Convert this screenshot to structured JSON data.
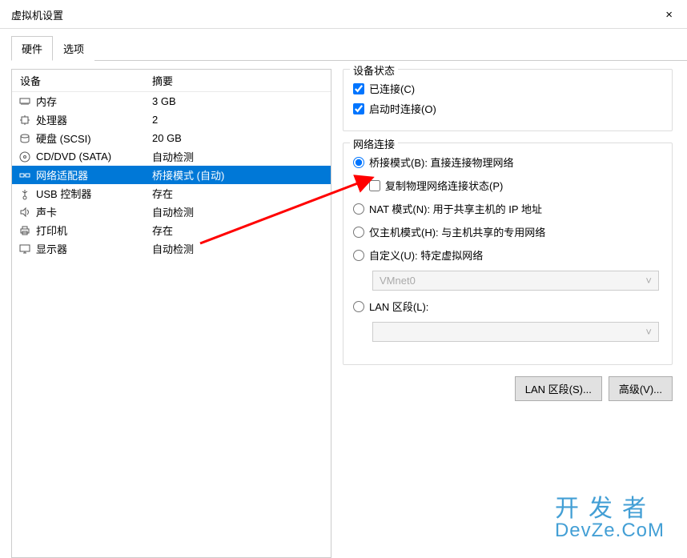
{
  "window": {
    "title": "虚拟机设置",
    "close_label": "×"
  },
  "tabs": {
    "hardware": "硬件",
    "options": "选项"
  },
  "table": {
    "header_device": "设备",
    "header_summary": "摘要",
    "rows": [
      {
        "icon": "memory",
        "name": "内存",
        "summary": "3 GB"
      },
      {
        "icon": "cpu",
        "name": "处理器",
        "summary": "2"
      },
      {
        "icon": "disk",
        "name": "硬盘 (SCSI)",
        "summary": "20 GB"
      },
      {
        "icon": "disc",
        "name": "CD/DVD (SATA)",
        "summary": "自动检测"
      },
      {
        "icon": "network",
        "name": "网络适配器",
        "summary": "桥接模式 (自动)"
      },
      {
        "icon": "usb",
        "name": "USB 控制器",
        "summary": "存在"
      },
      {
        "icon": "sound",
        "name": "声卡",
        "summary": "自动检测"
      },
      {
        "icon": "printer",
        "name": "打印机",
        "summary": "存在"
      },
      {
        "icon": "display",
        "name": "显示器",
        "summary": "自动检测"
      }
    ]
  },
  "right": {
    "status": {
      "title": "设备状态",
      "connected": "已连接(C)",
      "connect_at_power": "启动时连接(O)"
    },
    "network": {
      "title": "网络连接",
      "bridged": "桥接模式(B): 直接连接物理网络",
      "replicate": "复制物理网络连接状态(P)",
      "nat": "NAT 模式(N): 用于共享主机的 IP 地址",
      "hostonly": "仅主机模式(H): 与主机共享的专用网络",
      "custom": "自定义(U): 特定虚拟网络",
      "custom_value": "VMnet0",
      "lan_segment": "LAN 区段(L):",
      "lan_value": ""
    },
    "buttons": {
      "lan_segment_btn": "LAN 区段(S)...",
      "advanced_btn": "高级(V)..."
    }
  },
  "watermark": {
    "line1": "开发者",
    "line2": "DevZe.CoM"
  }
}
